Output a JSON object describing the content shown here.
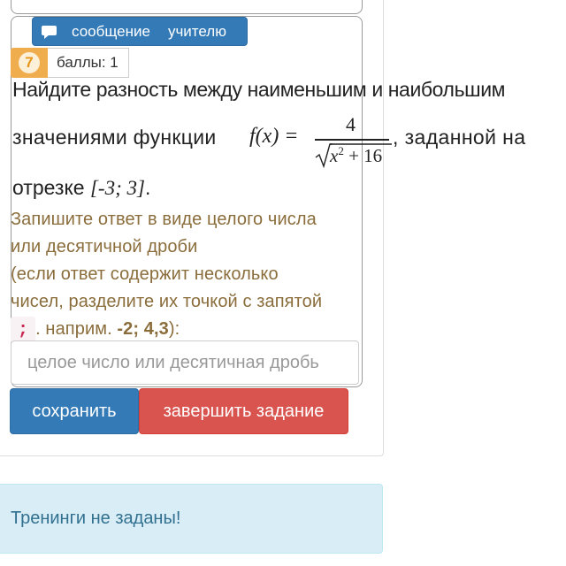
{
  "message_button": {
    "word1": "сообщение",
    "word2": "учителю"
  },
  "task": {
    "number": "7",
    "score_label": "баллы: 1",
    "question": {
      "line1": "Найдите разность между наименьшим и наибольшим",
      "line2_prefix": "значениями  функции",
      "function_lhs": "f(x) =",
      "fraction_numerator": "4",
      "radicand_base": "x",
      "radicand_exp": "2",
      "radicand_tail": " + 16",
      "line2_suffix": ", заданной на",
      "line3_prefix": "отрезке",
      "interval": "[-3; 3]",
      "line3_suffix": "."
    },
    "instruction": {
      "line1": "Запишите ответ в виде целого числа",
      "line2": "или десятичной дроби",
      "line3": "(если ответ содержит несколько",
      "line4": "чисел, разделите их точкой с запятой",
      "semicolon": ";",
      "example_prefix": ". наприм.",
      "example": "-2; 4,3",
      "example_suffix": "):"
    },
    "answer_placeholder": "целое число или десятичная дробь"
  },
  "buttons": {
    "save": "сохранить",
    "finish": "завершить задание"
  },
  "alert": {
    "text": "Тренинги не заданы!"
  },
  "colors": {
    "primary": "#337ab7",
    "danger": "#d9534f",
    "warning": "#f0ad4e",
    "instruction_text": "#8a6d3b",
    "info_bg": "#d9edf7",
    "info_text": "#31708f"
  },
  "icons": {
    "message": "comment-icon"
  }
}
